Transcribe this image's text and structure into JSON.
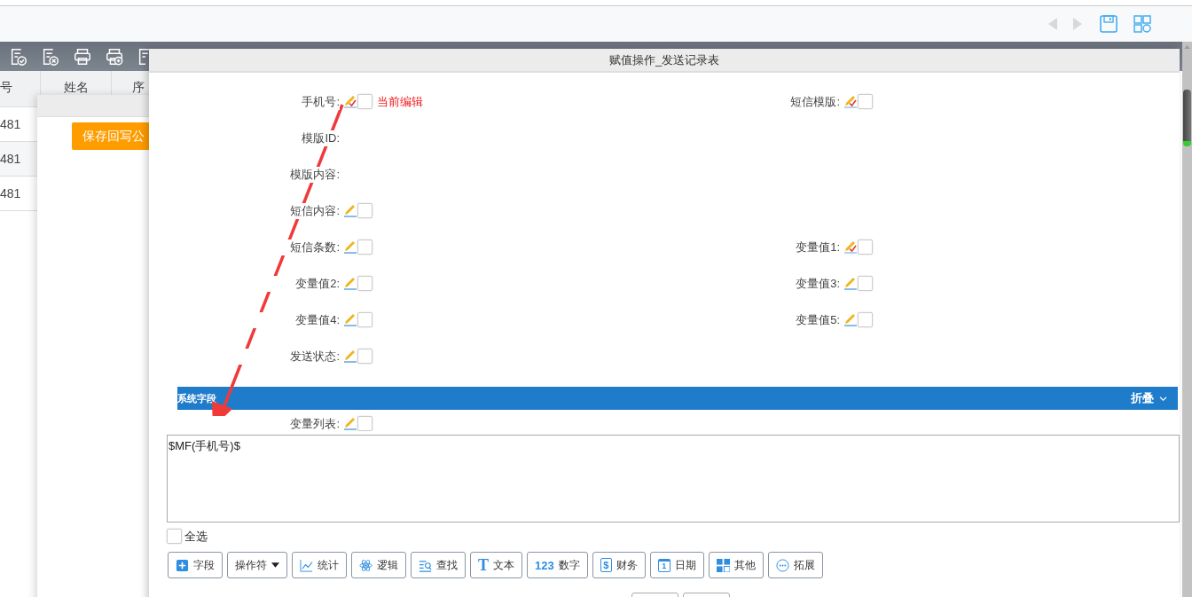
{
  "table": {
    "columns": [
      "号",
      "姓名",
      "序"
    ],
    "rows": [
      [
        "481"
      ],
      [
        "481"
      ],
      [
        "481"
      ]
    ]
  },
  "back_dialog": {
    "button": "保存回写公"
  },
  "dialog": {
    "title": "赋值操作_发送记录表",
    "rows": [
      [
        {
          "label": "手机号:",
          "kind": "editable",
          "marked": true,
          "checked": false,
          "note": "当前编辑"
        },
        {
          "label": "短信模版:",
          "kind": "editable",
          "marked": true,
          "checked": false
        }
      ],
      [
        {
          "label": "模版ID:",
          "kind": "plain"
        }
      ],
      [
        {
          "label": "模版内容:",
          "kind": "plain"
        }
      ],
      [
        {
          "label": "短信内容:",
          "kind": "editable",
          "marked": false,
          "checked": false
        }
      ],
      [
        {
          "label": "短信条数:",
          "kind": "editable",
          "marked": false,
          "checked": false
        },
        {
          "label": "变量值1:",
          "kind": "editable",
          "marked": true,
          "checked": false
        }
      ],
      [
        {
          "label": "变量值2:",
          "kind": "editable",
          "marked": false,
          "checked": false
        },
        {
          "label": "变量值3:",
          "kind": "editable",
          "marked": false,
          "checked": false
        }
      ],
      [
        {
          "label": "变量值4:",
          "kind": "editable",
          "marked": false,
          "checked": false
        },
        {
          "label": "变量值5:",
          "kind": "editable",
          "marked": false,
          "checked": false
        }
      ],
      [
        {
          "label": "发送状态:",
          "kind": "editable",
          "marked": false,
          "checked": false
        }
      ]
    ],
    "section": {
      "title": "系统字段",
      "toggle": "折叠",
      "expanded": true,
      "rows": [
        [
          {
            "label": "变量列表:",
            "kind": "editable",
            "marked": false,
            "checked": false
          }
        ]
      ]
    },
    "formula": "$MF(手机号)$",
    "select_all": {
      "label": "全选",
      "checked": false
    },
    "tools": [
      {
        "label": "字段",
        "kind": "add"
      },
      {
        "label": "操作符",
        "kind": "dropdown"
      },
      {
        "label": "统计",
        "kind": "chart"
      },
      {
        "label": "逻辑",
        "kind": "atom"
      },
      {
        "label": "查找",
        "kind": "search"
      },
      {
        "label": "文本",
        "kind": "text",
        "glyph": "T"
      },
      {
        "label": "数字",
        "kind": "number",
        "glyph": "123"
      },
      {
        "label": "财务",
        "kind": "money",
        "glyph": "$"
      },
      {
        "label": "日期",
        "kind": "calendar",
        "glyph": "1"
      },
      {
        "label": "其他",
        "kind": "grid"
      },
      {
        "label": "拓展",
        "kind": "more"
      }
    ]
  }
}
